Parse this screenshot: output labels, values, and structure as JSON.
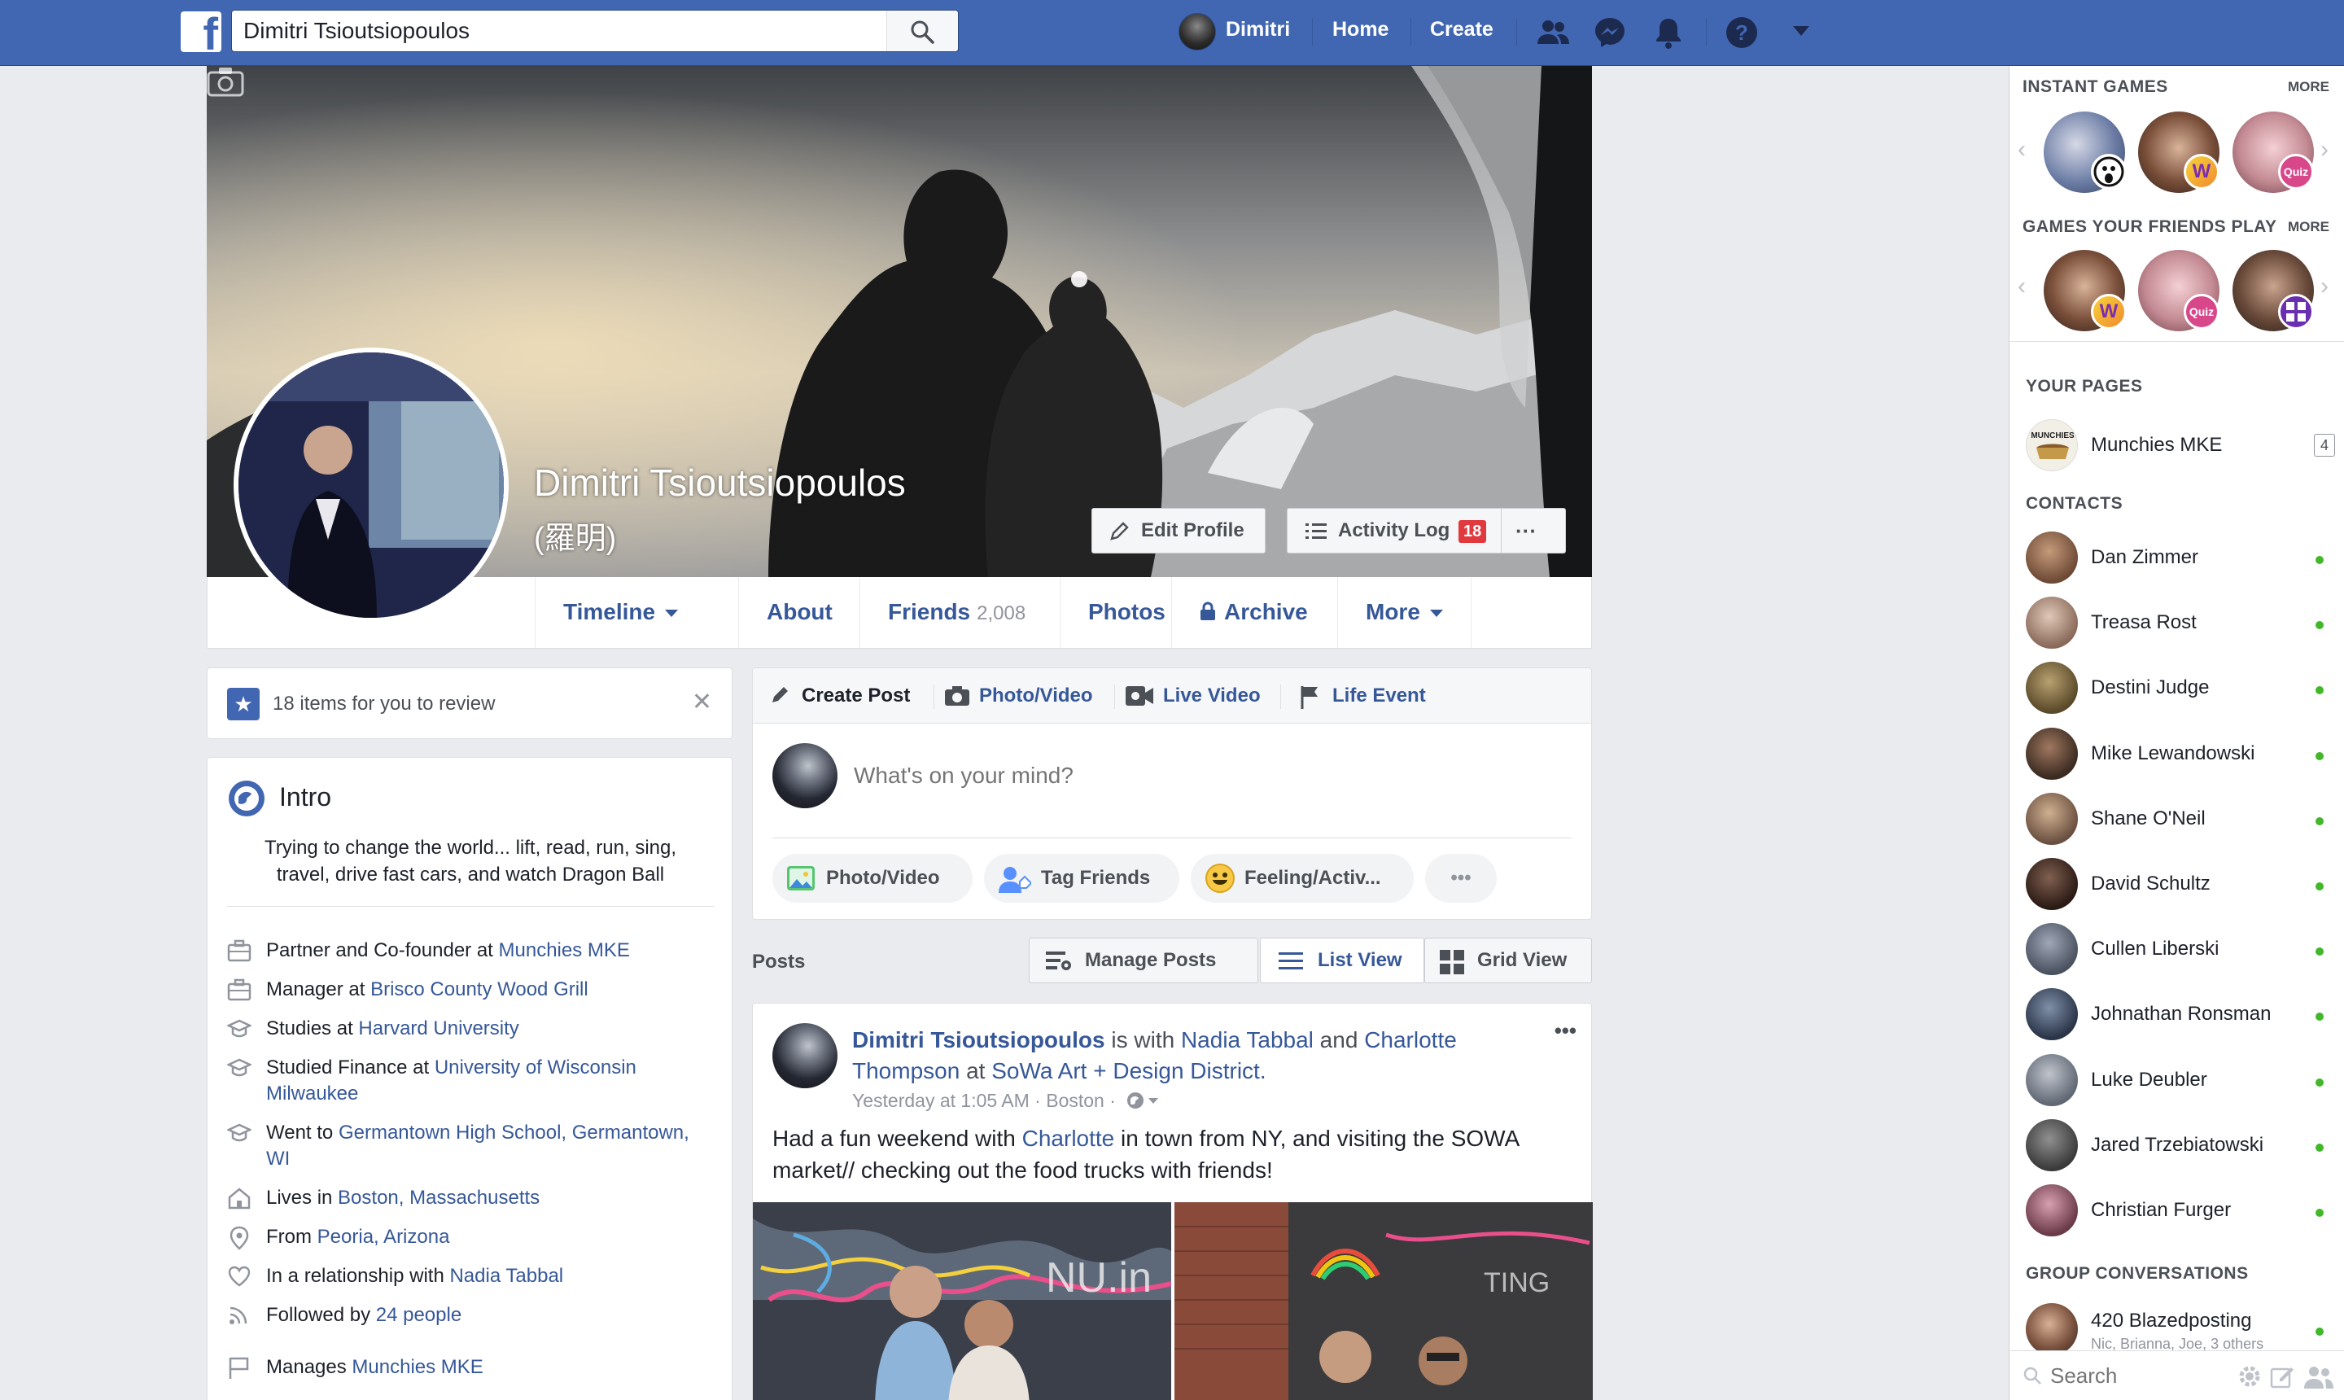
{
  "topbar": {
    "logo": "f",
    "search_value": "Dimitri Tsioutsiopoulos",
    "user_name": "Dimitri",
    "home": "Home",
    "create": "Create"
  },
  "cover": {
    "name": "Dimitri Tsioutsiopoulos",
    "alt_name": "(羅明)",
    "edit_profile": "Edit Profile",
    "activity_log": "Activity Log",
    "activity_count": "18",
    "more_dots": "···"
  },
  "profile_nav": {
    "timeline": "Timeline",
    "about": "About",
    "friends": "Friends",
    "friends_count": "2,008",
    "photos": "Photos",
    "archive": "Archive",
    "more": "More"
  },
  "review": {
    "text": "18 items for you to review"
  },
  "intro": {
    "title": "Intro",
    "bio": "Trying to change the world... lift, read, run, sing, travel, drive fast cars, and watch Dragon Ball",
    "rows": [
      {
        "pre": "Partner and Co-founder at ",
        "link": "Munchies MKE",
        "icon": "briefcase-icon"
      },
      {
        "pre": "Manager at ",
        "link": "Brisco County Wood Grill",
        "icon": "briefcase-icon"
      },
      {
        "pre": "Studies at ",
        "link": "Harvard University",
        "icon": "graduation-cap-icon"
      },
      {
        "pre": "Studied Finance at ",
        "link": "University of Wisconsin Milwaukee",
        "icon": "graduation-cap-icon"
      },
      {
        "pre": "Went to ",
        "link": "Germantown High School, Germantown, WI",
        "icon": "graduation-cap-icon"
      },
      {
        "pre": "Lives in ",
        "link": "Boston, Massachusetts",
        "icon": "home-icon"
      },
      {
        "pre": "From ",
        "link": "Peoria, Arizona",
        "icon": "location-pin-icon"
      },
      {
        "pre": "In a relationship with ",
        "link": "Nadia Tabbal",
        "icon": "heart-icon"
      },
      {
        "pre": "Followed by ",
        "link": "24 people",
        "icon": "rss-icon"
      },
      {
        "pre": "Manages ",
        "link": "Munchies MKE",
        "icon": "flag-icon"
      }
    ]
  },
  "composer": {
    "create_post": "Create Post",
    "photo_video_tab": "Photo/Video",
    "live_video": "Live Video",
    "life_event": "Life Event",
    "placeholder": "What's on your mind?",
    "photo_video": "Photo/Video",
    "tag_friends": "Tag Friends",
    "feeling": "Feeling/Activ...",
    "more": "•••"
  },
  "posts_bar": {
    "label": "Posts",
    "manage": "Manage Posts",
    "list_view": "List View",
    "grid_view": "Grid View"
  },
  "post": {
    "author": "Dimitri Tsioutsiopoulos",
    "with_text": " is with ",
    "friend1": "Nadia Tabbal",
    "and_text": " and ",
    "friend2": "Charlotte Thompson",
    "at_text": " at ",
    "place": "SoWa Art + Design District.",
    "meta": "Yesterday at 1:05 AM · Boston ·",
    "body_pre": "Had a fun weekend with ",
    "body_link": "Charlotte",
    "body_post": " in town from NY, and visiting the SOWA market// checking out the food trucks with friends!",
    "dots": "•••"
  },
  "sidebar": {
    "instant_games": "INSTANT GAMES",
    "friends_games": "GAMES YOUR FRIENDS PLAY",
    "more": "MORE",
    "your_pages": "YOUR PAGES",
    "page_name": "Munchies MKE",
    "page_count": "4",
    "contacts_title": "CONTACTS",
    "contacts": [
      "Dan Zimmer",
      "Treasa Rost",
      "Destini Judge",
      "Mike Lewandowski",
      "Shane O'Neil",
      "David Schultz",
      "Cullen Liberski",
      "Johnathan Ronsman",
      "Luke Deubler",
      "Jared Trzebiatowski",
      "Christian Furger"
    ],
    "group_title": "GROUP CONVERSATIONS",
    "group_name": "420 Blazedposting",
    "group_members": "Nic, Brianna, Joe, 3 others",
    "search_placeholder": "Search"
  }
}
